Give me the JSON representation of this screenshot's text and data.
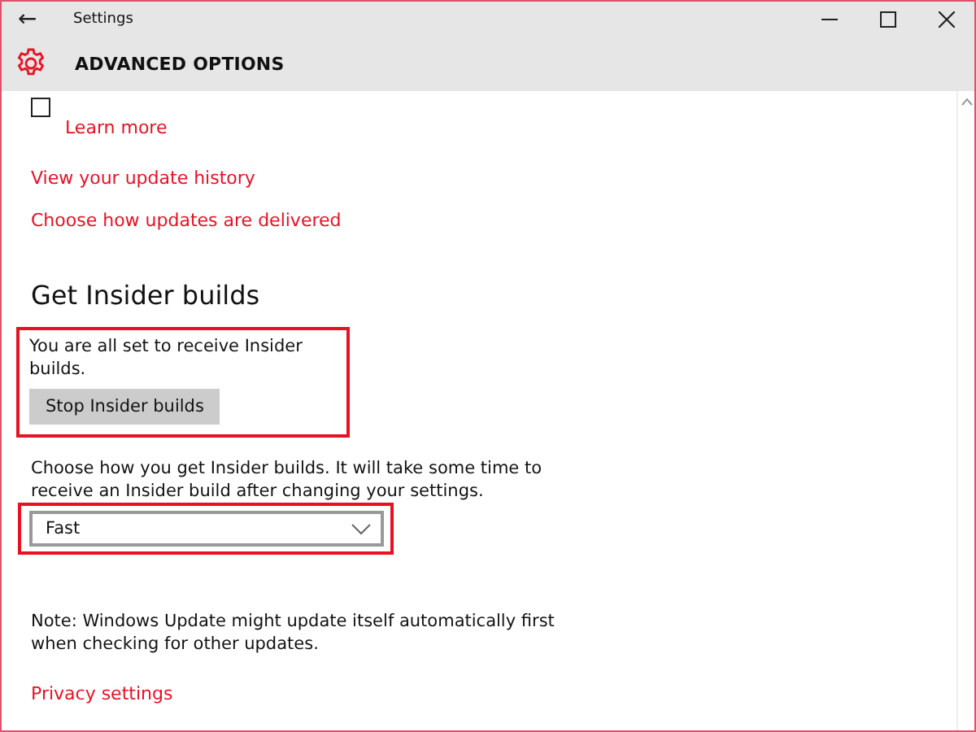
{
  "window": {
    "title": "Settings",
    "back": "←"
  },
  "header": {
    "title": "ADVANCED OPTIONS"
  },
  "defer_checkbox": {
    "checked": false
  },
  "links_top": [
    "Learn more",
    "View your update history",
    "Choose how updates are delivered"
  ],
  "insider": {
    "heading": "Get Insider builds",
    "status": "You are all set to receive Insider builds.",
    "button": "Stop Insider builds",
    "description": "Choose how you get Insider builds. It will take some time to receive an Insider build after changing your settings.",
    "dropdown": {
      "value": "Fast"
    }
  },
  "note": "Note: Windows Update might update itself automatically first when checking for other updates.",
  "privacy_link": "Privacy settings"
}
